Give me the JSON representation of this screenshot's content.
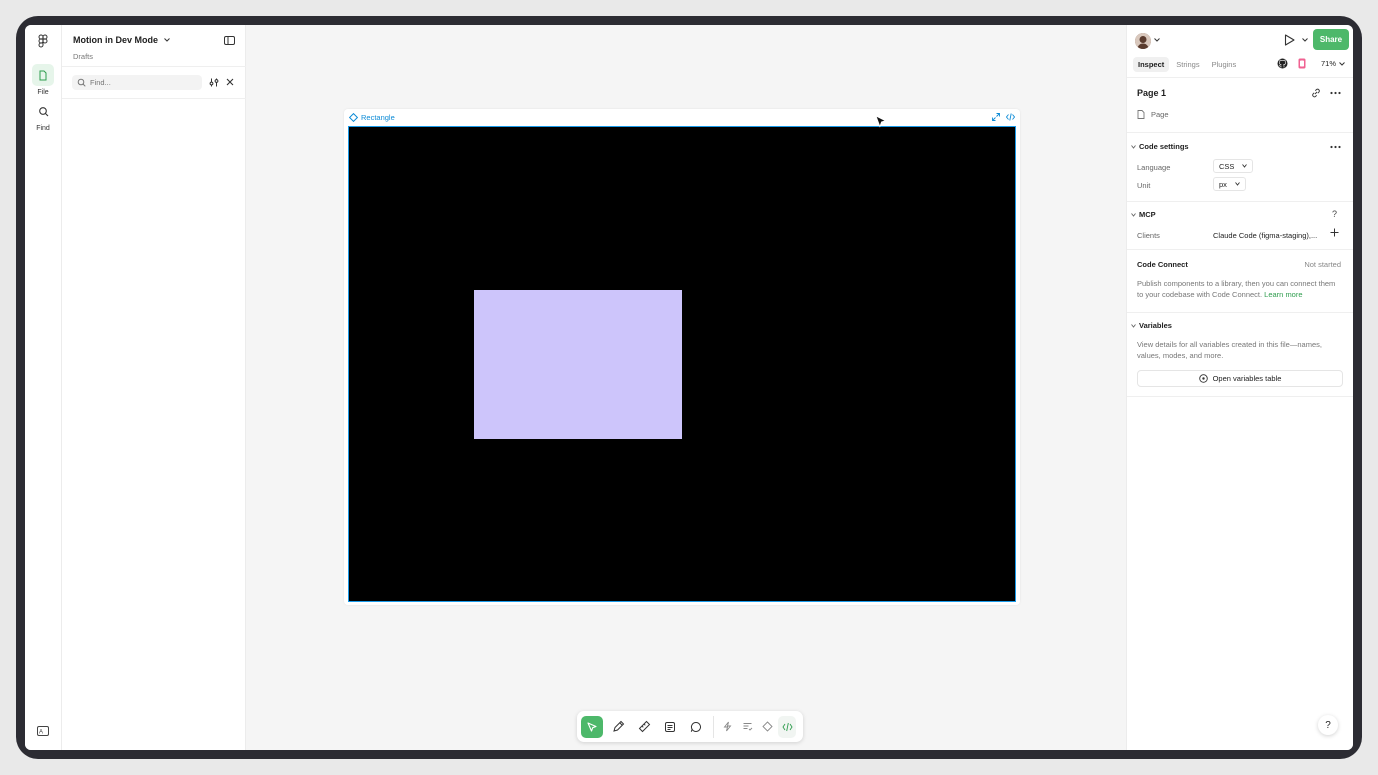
{
  "rail": {
    "file_label": "File",
    "find_label": "Find"
  },
  "panel": {
    "file_title": "Motion in Dev Mode",
    "file_subtitle": "Drafts",
    "search_placeholder": "Find..."
  },
  "canvas": {
    "frame_label": "Rectangle",
    "frame_color": "#000000",
    "rect_color": "#cdc5fb",
    "selection_color": "#1a9bea"
  },
  "header": {
    "share_label": "Share",
    "zoom": "71%",
    "accent": "#4db86a"
  },
  "tabs": [
    {
      "label": "Inspect"
    },
    {
      "label": "Strings"
    },
    {
      "label": "Plugins"
    }
  ],
  "page": {
    "title": "Page 1",
    "type_label": "Page"
  },
  "code_settings": {
    "heading": "Code settings",
    "language_label": "Language",
    "language_value": "CSS",
    "unit_label": "Unit",
    "unit_value": "px"
  },
  "mcp": {
    "heading": "MCP",
    "clients_label": "Clients",
    "clients_value": "Claude Code (figma-staging),..."
  },
  "code_connect": {
    "heading": "Code Connect",
    "status": "Not started",
    "description": "Publish components to a library, then you can connect them to your codebase with Code Connect.",
    "link": "Learn more"
  },
  "variables": {
    "heading": "Variables",
    "description": "View details for all variables created in this file—names, values, modes, and more.",
    "button_label": "Open variables table"
  },
  "help_label": "?"
}
